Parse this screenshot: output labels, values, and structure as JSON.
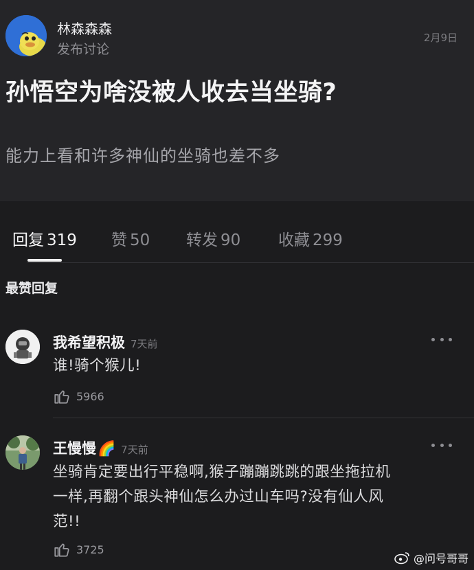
{
  "post": {
    "author": "林森森森",
    "subtitle": "发布讨论",
    "date": "2月9日",
    "title": "孙悟空为啥没被人收去当坐骑?",
    "body": "能力上看和许多神仙的坐骑也差不多"
  },
  "tabs": [
    {
      "label": "回复",
      "count": "319",
      "active": true
    },
    {
      "label": "赞",
      "count": "50",
      "active": false
    },
    {
      "label": "转发",
      "count": "90",
      "active": false
    },
    {
      "label": "收藏",
      "count": "299",
      "active": false
    }
  ],
  "section_title": "最赞回复",
  "comments": [
    {
      "name": "我希望积极",
      "time": "7天前",
      "text": "谁!骑个猴儿!",
      "likes": "5966",
      "avatar_icon": "astronaut-avatar-icon"
    },
    {
      "name": "王慢慢",
      "badge": "🌈",
      "time": "7天前",
      "text_lines": [
        "坐骑肯定要出行平稳啊,猴子蹦蹦跳跳的跟坐拖拉机",
        "一样,再翻个跟头神仙怎么办过山车吗?没有仙人风",
        "范!!"
      ],
      "likes": "3725",
      "avatar_icon": "person-photo-avatar-icon"
    }
  ],
  "watermark": "@问号哥哥",
  "colors": {
    "background": "#1c1c1e",
    "card": "#252528",
    "primary_text": "#f4f4f5",
    "secondary_text": "#8e8e93",
    "avatar_blue": "#2f6fd6"
  }
}
